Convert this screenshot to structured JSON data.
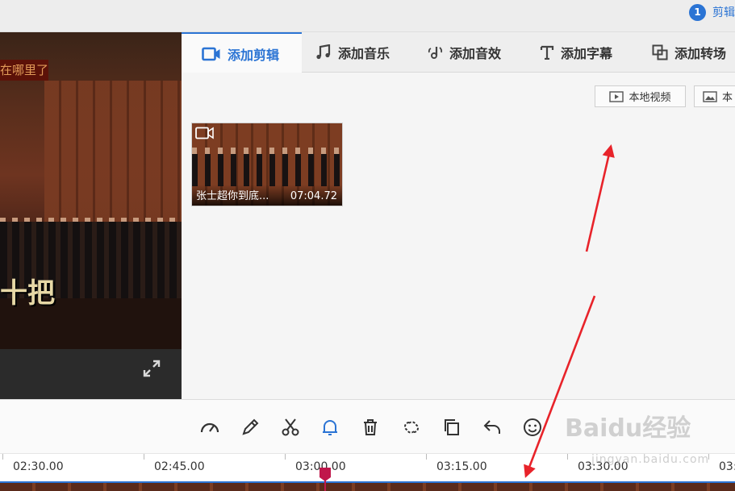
{
  "header": {
    "step_number": "1",
    "step_label": "剪辑"
  },
  "preview": {
    "banner_text": "在哪里了",
    "subtitle_text": "十把",
    "fullscreen_icon": "expand-icon"
  },
  "tabs": [
    {
      "label": "添加剪辑",
      "icon": "video-camera-icon",
      "active": true
    },
    {
      "label": "添加音乐",
      "icon": "music-note-icon",
      "active": false
    },
    {
      "label": "添加音效",
      "icon": "sound-effect-icon",
      "active": false
    },
    {
      "label": "添加字幕",
      "icon": "text-t-icon",
      "active": false
    },
    {
      "label": "添加转场",
      "icon": "transition-icon",
      "active": false
    }
  ],
  "library": {
    "local_video_label": "本地视频",
    "image_button_label": "本",
    "clips": [
      {
        "name": "张士超你到底...",
        "duration": "07:04.72"
      }
    ]
  },
  "toolbar": {
    "tools": [
      "speed-icon",
      "pencil-icon",
      "scissors-icon",
      "bell-icon",
      "trash-icon",
      "detach-icon",
      "copy-icon",
      "undo-icon",
      "emoji-icon"
    ]
  },
  "timeline": {
    "ticks": [
      "02:30.00",
      "02:45.00",
      "03:00.00",
      "03:15.00",
      "03:30.00",
      "03:"
    ],
    "playhead_time": "03:00.00"
  },
  "watermark": {
    "text": "Baidu经验",
    "sub": "jingyan.baidu.com"
  },
  "colors": {
    "accent": "#2b74d4",
    "arrow": "#e8232a",
    "playhead": "#c0174b"
  }
}
